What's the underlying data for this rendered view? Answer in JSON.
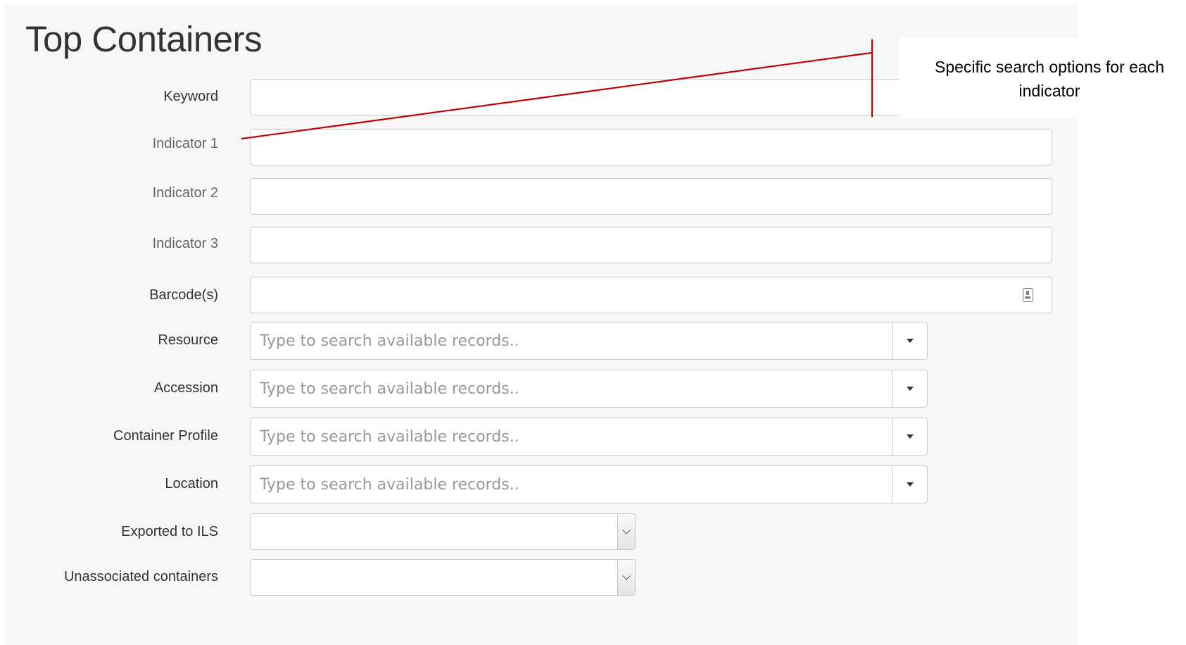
{
  "page": {
    "title": "Top Containers"
  },
  "form": {
    "fields": [
      {
        "label": "Keyword",
        "value": "",
        "type": "text"
      },
      {
        "label": "Indicator 1",
        "value": "",
        "type": "text"
      },
      {
        "label": "Indicator 2",
        "value": "",
        "type": "text"
      },
      {
        "label": "Indicator 3",
        "value": "",
        "type": "text"
      },
      {
        "label": "Barcode(s)",
        "value": "",
        "type": "text",
        "icon": "barcode-icon"
      },
      {
        "label": "Resource",
        "placeholder": "Type to search available records..",
        "type": "combobox"
      },
      {
        "label": "Accession",
        "placeholder": "Type to search available records..",
        "type": "combobox"
      },
      {
        "label": "Container Profile",
        "placeholder": "Type to search available records..",
        "type": "combobox"
      },
      {
        "label": "Location",
        "placeholder": "Type to search available records..",
        "type": "combobox"
      },
      {
        "label": "Exported to ILS",
        "value": "",
        "type": "select"
      },
      {
        "label": "Unassociated containers",
        "value": "",
        "type": "select"
      }
    ]
  },
  "annotation": {
    "text": "Specific search options for each indicator",
    "line_color": "#c00000"
  },
  "colors": {
    "background": "#f7f7f7",
    "annotation_line": "#c00000"
  }
}
